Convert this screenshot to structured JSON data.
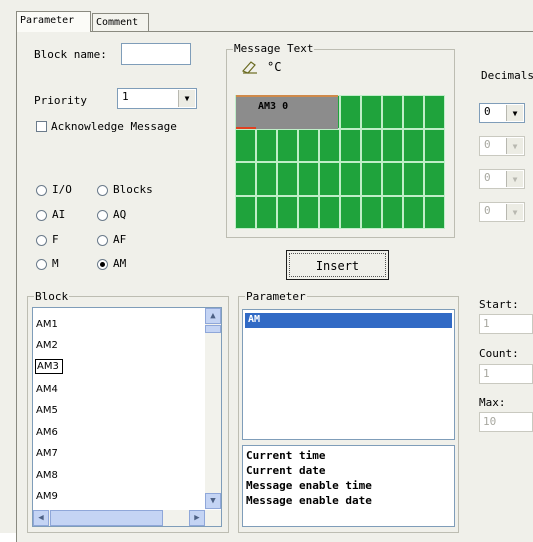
{
  "tabs": [
    {
      "label": "Parameter"
    },
    {
      "label": "Comment"
    }
  ],
  "block_name": {
    "label": "Block name:",
    "value": ""
  },
  "priority": {
    "label": "Priority",
    "value": "1"
  },
  "acknowledge": {
    "label": "Acknowledge Message",
    "checked": false
  },
  "radios": [
    {
      "label": "I/O",
      "selected": false
    },
    {
      "label": "Blocks",
      "selected": false
    },
    {
      "label": "AI",
      "selected": false
    },
    {
      "label": "AQ",
      "selected": false
    },
    {
      "label": "F",
      "selected": false
    },
    {
      "label": "AF",
      "selected": false
    },
    {
      "label": "M",
      "selected": false
    },
    {
      "label": "AM",
      "selected": true
    }
  ],
  "message_text": {
    "title": "Message Text",
    "degree_symbol": "°C",
    "eraser_icon": "eraser-icon",
    "cell_text": "AM3 0",
    "grid_color": "#1fa33c",
    "cell_color": "#8c8c8c"
  },
  "decimals": {
    "label": "Decimals",
    "values": [
      "0",
      "0",
      "0",
      "0"
    ]
  },
  "insert_button": "Insert",
  "block": {
    "title": "Block",
    "items": [
      "AM1",
      "AM2",
      "AM3",
      "AM4",
      "AM5",
      "AM6",
      "AM7",
      "AM8",
      "AM9"
    ],
    "selected": "AM3"
  },
  "parameter": {
    "title": "Parameter",
    "selected_item": "AM",
    "extra_items": [
      "Current time",
      "Current date",
      "Message enable time",
      "Message enable date"
    ]
  },
  "right_fields": {
    "start_label": "Start:",
    "start_value": "1",
    "count_label": "Count:",
    "count_value": "1",
    "max_label": "Max:",
    "max_value": "10"
  }
}
